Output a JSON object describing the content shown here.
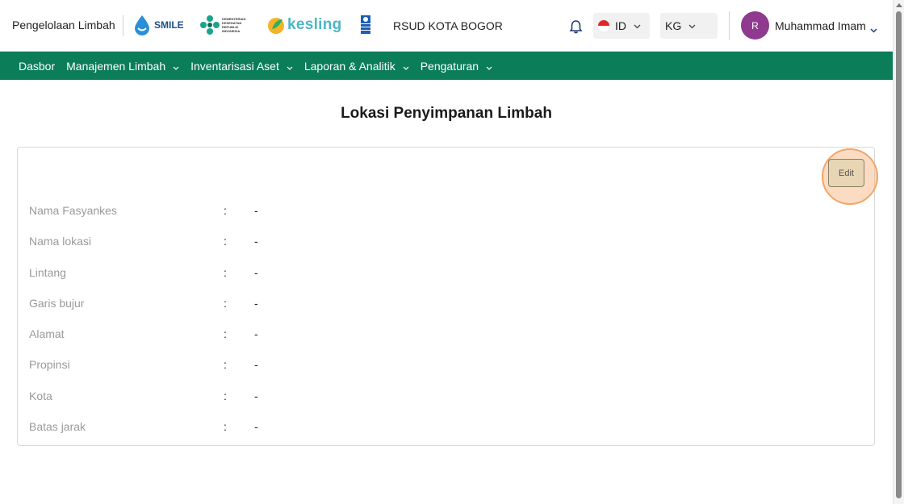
{
  "header": {
    "app_title": "Pengelolaan Limbah",
    "logos": {
      "smile": "SMILE",
      "kemenkes": "KEMENTERIAN KESEHATAN REPUBLIK INDONESIA",
      "kesling": "kesling",
      "undp": "undp-logo"
    },
    "hospital": "RSUD KOTA BOGOR",
    "language": {
      "code": "ID",
      "flag": "indonesia-flag"
    },
    "unit": "KG",
    "user": {
      "initial": "R",
      "name": "Muhammad Imam"
    }
  },
  "nav": {
    "items": [
      {
        "label": "Dasbor",
        "has_dropdown": false
      },
      {
        "label": "Manajemen Limbah",
        "has_dropdown": true
      },
      {
        "label": "Inventarisasi Aset",
        "has_dropdown": true
      },
      {
        "label": "Laporan & Analitik",
        "has_dropdown": true
      },
      {
        "label": "Pengaturan",
        "has_dropdown": true
      }
    ]
  },
  "page": {
    "title": "Lokasi Penyimpanan Limbah",
    "edit_label": "Edit",
    "fields": [
      {
        "label": "Nama Fasyankes",
        "value": "-"
      },
      {
        "label": "Nama lokasi",
        "value": "-"
      },
      {
        "label": "Lintang",
        "value": "-"
      },
      {
        "label": "Garis bujur",
        "value": "-"
      },
      {
        "label": "Alamat",
        "value": "-"
      },
      {
        "label": "Propinsi",
        "value": "-"
      },
      {
        "label": "Kota",
        "value": "-"
      },
      {
        "label": "Batas jarak",
        "value": "-"
      }
    ],
    "separator": ":"
  },
  "colors": {
    "nav_bg": "#0b7d58",
    "avatar_bg": "#8f3a8f",
    "edit_highlight": "#f3a567",
    "edit_button_bg": "#e8d5b4"
  }
}
